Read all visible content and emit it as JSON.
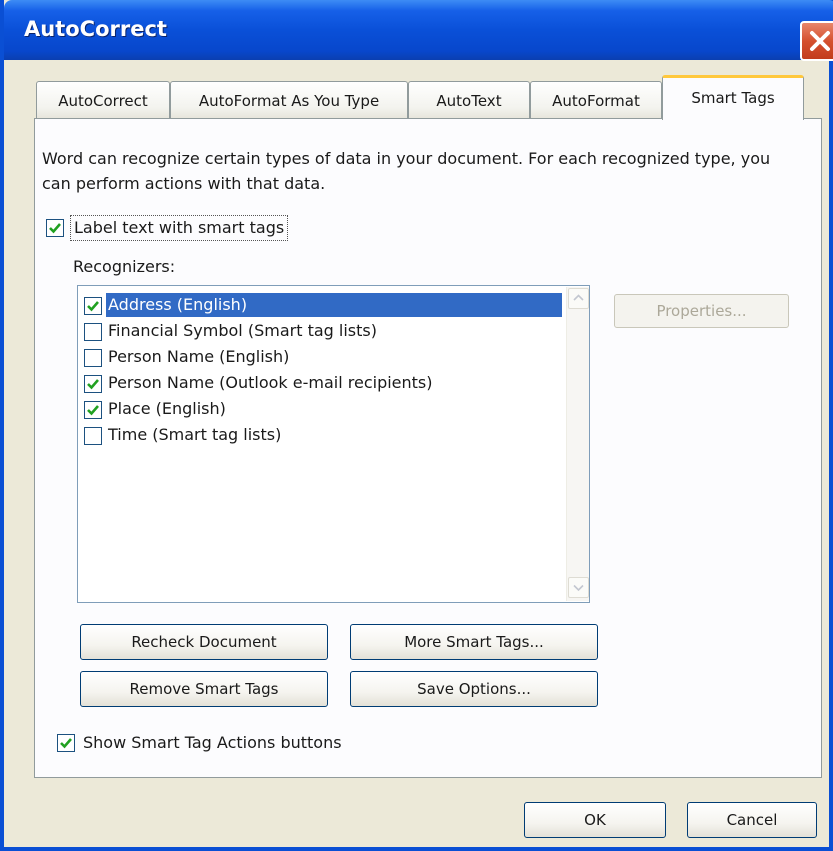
{
  "window": {
    "title": "AutoCorrect"
  },
  "tabs": [
    {
      "label": "AutoCorrect"
    },
    {
      "label": "AutoFormat As You Type"
    },
    {
      "label": "AutoText"
    },
    {
      "label": "AutoFormat"
    },
    {
      "label": "Smart Tags",
      "active": true
    }
  ],
  "smart_tags": {
    "description": "Word can recognize certain types of data in your document. For each recognized type, you can perform actions with that data.",
    "label_text_checkbox": {
      "label": "Label text with smart tags",
      "checked": true
    },
    "recognizers_label": "Recognizers:",
    "recognizers": [
      {
        "label": "Address (English)",
        "checked": true,
        "selected": true
      },
      {
        "label": "Financial Symbol (Smart tag lists)",
        "checked": false
      },
      {
        "label": "Person Name (English)",
        "checked": false
      },
      {
        "label": "Person Name (Outlook e-mail recipients)",
        "checked": true
      },
      {
        "label": "Place (English)",
        "checked": true
      },
      {
        "label": "Time (Smart tag lists)",
        "checked": false
      }
    ],
    "properties_button": "Properties...",
    "recheck_button": "Recheck Document",
    "more_button": "More Smart Tags...",
    "remove_button": "Remove Smart Tags",
    "save_button": "Save Options...",
    "show_actions_checkbox": {
      "label": "Show Smart Tag Actions buttons",
      "checked": true
    }
  },
  "footer": {
    "ok_button": "OK",
    "cancel_button": "Cancel"
  },
  "colors": {
    "title_bar": "#0a50d8",
    "selection": "#316ac5",
    "check": "#21a121",
    "active_tab_accent": "#ffc83c",
    "close_button": "#d5512f"
  }
}
